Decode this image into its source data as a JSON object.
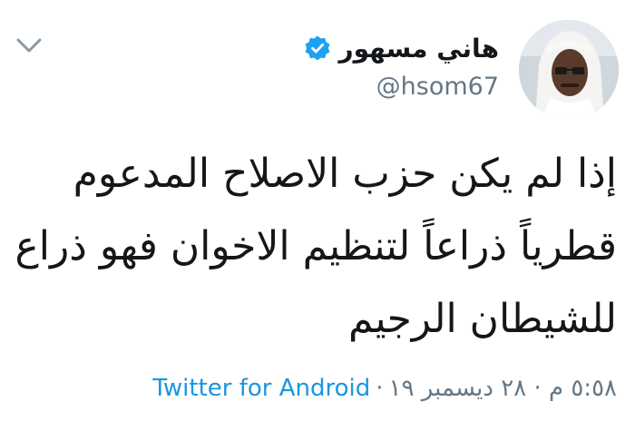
{
  "author": {
    "display_name": "هاني مسهور",
    "handle": "@hsom67",
    "verified_color": "#1da1f2",
    "avatar_icon": "profile-photo"
  },
  "tweet": {
    "lines": [
      "إذا لم يكن حزب الاصلاح المدعوم",
      "قطرياً ذراعاً لتنظيم الاخوان فهو ذراع",
      "للشيطان الرجيم"
    ]
  },
  "meta": {
    "timestamp": "٥:٥٨ م · ٢٨ ديسمبر ١٩",
    "separator": "·",
    "source": "Twitter for Android"
  },
  "colors": {
    "link": "#1b95e0",
    "secondary": "#657786",
    "text": "#14171a"
  },
  "icons": {
    "menu": "chevron-down-icon",
    "verified": "verified-badge-icon"
  }
}
